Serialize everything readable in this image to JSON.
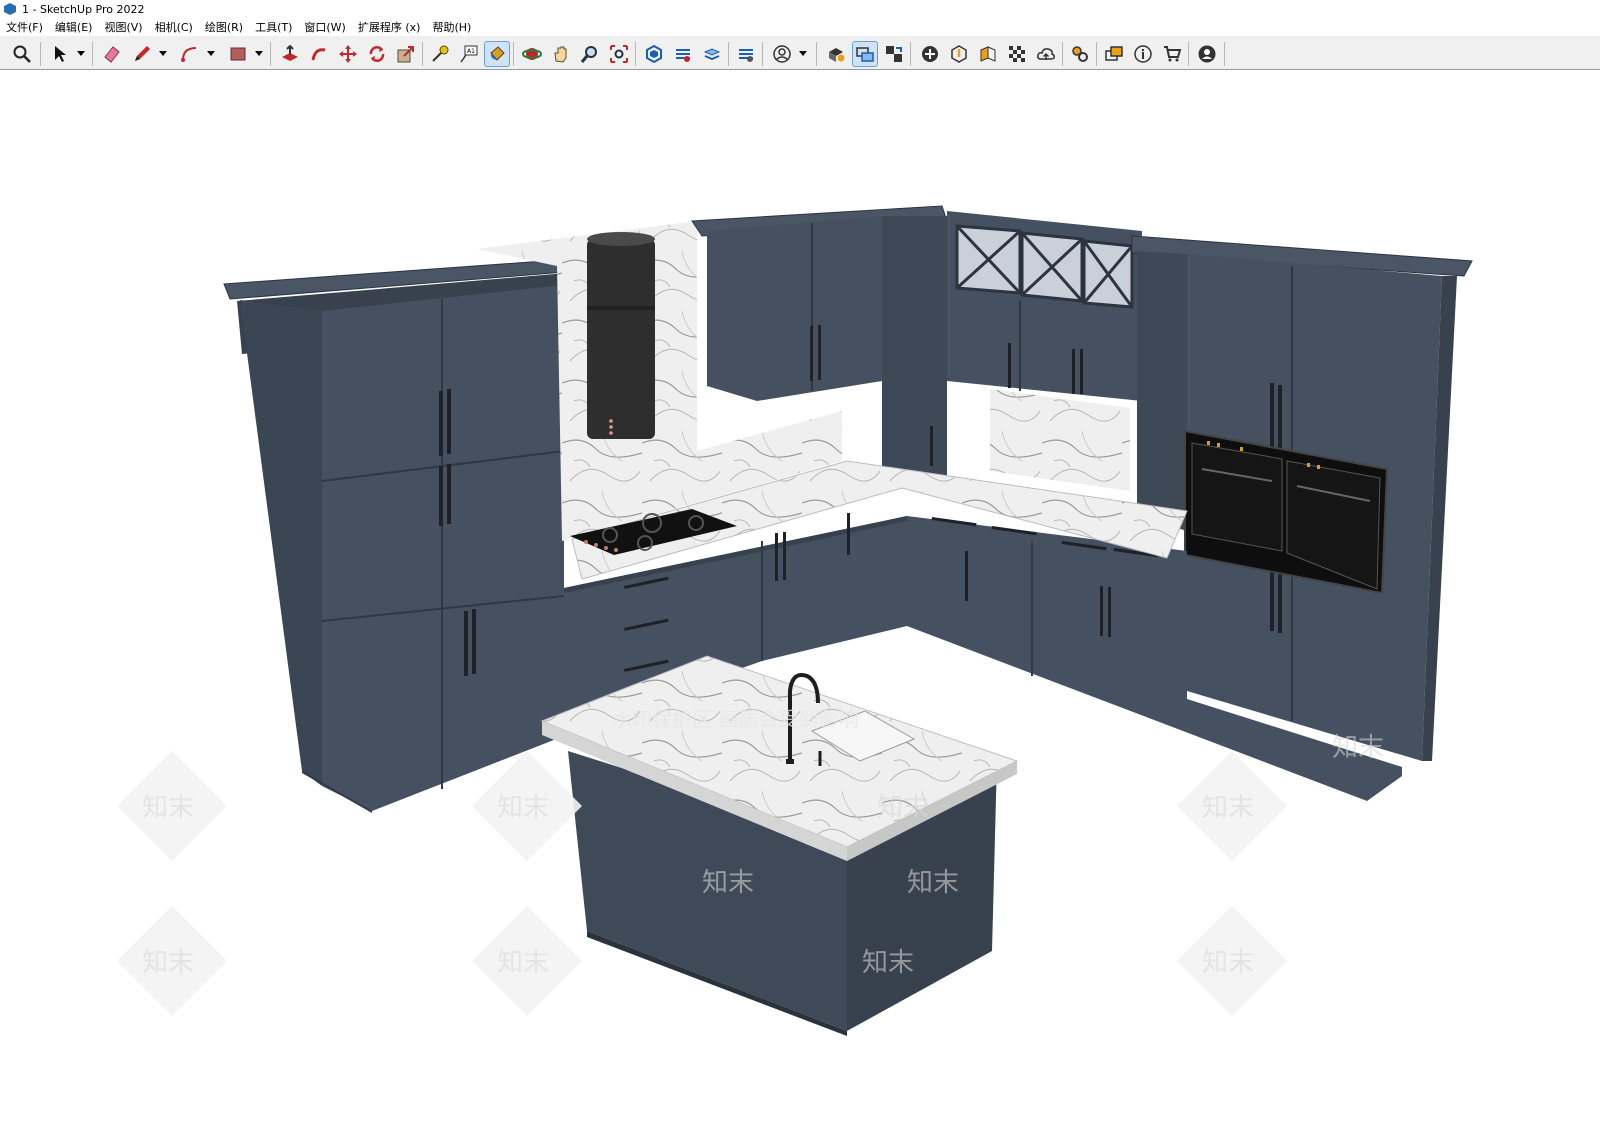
{
  "window": {
    "title": "1 - SketchUp Pro 2022"
  },
  "menus": [
    "文件(F)",
    "编辑(E)",
    "视图(V)",
    "相机(C)",
    "绘图(R)",
    "工具(T)",
    "窗口(W)",
    "扩展程序 (x)",
    "帮助(H)"
  ],
  "toolbar": {
    "icons": [
      "zoom-extents",
      "select",
      "eraser",
      "pencil",
      "arc",
      "rectangle",
      "push-pull",
      "follow-me",
      "move",
      "rotate",
      "scale",
      "tape-measure",
      "text",
      "paint-bucket",
      "orbit",
      "pan",
      "zoom",
      "zoom-window",
      "3d-warehouse",
      "extension-warehouse",
      "layout",
      "extension-manager",
      "profile",
      "model-info",
      "dynamic-components",
      "component-options",
      "add-location",
      "solid-inspector",
      "sandbox",
      "match-photo",
      "cloud",
      "settings",
      "trimble-connect",
      "info",
      "shop",
      "account"
    ],
    "active": "paint-bucket"
  },
  "watermark": {
    "banner": "水印保护区  画质会受到影响",
    "mark": "知末"
  },
  "colors": {
    "cabinet": "#455160",
    "cabinet_dark": "#38424f",
    "marble": "#ececec",
    "appliance": "#111111",
    "toolbar_bg": "#f0f0f0"
  }
}
